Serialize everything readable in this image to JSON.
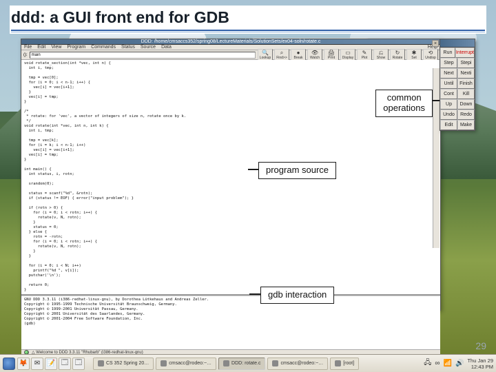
{
  "slide": {
    "title": "ddd: a GUI front end for GDB",
    "number": "29"
  },
  "background": {
    "scene": "mountain-meadow"
  },
  "ddd": {
    "titlebar": "DDD: /home/cmsaccs352/spring08/LectureMaterials/SolutionSets/ex04-soln/rotate.c",
    "close_btn": "×",
    "menu": {
      "file": "File",
      "edit": "Edit",
      "view": "View",
      "program": "Program",
      "commands": "Commands",
      "status": "Status",
      "source": "Source",
      "data": "Data",
      "help": "Help"
    },
    "locator": {
      "label": "():",
      "value": "main"
    },
    "toolbar": [
      {
        "icon": "🔍",
        "label": "Lookup"
      },
      {
        "icon": "⌕",
        "label": "Find>>"
      },
      {
        "icon": "●",
        "label": "Break"
      },
      {
        "icon": "👁",
        "label": "Watch"
      },
      {
        "icon": "🖨",
        "label": "Print"
      },
      {
        "icon": "▭",
        "label": "Display"
      },
      {
        "icon": "✎",
        "label": "Plot"
      },
      {
        "icon": "⎌",
        "label": "Show"
      },
      {
        "icon": "↻",
        "label": "Rotate"
      },
      {
        "icon": "✱",
        "label": "Set"
      },
      {
        "icon": "⟲",
        "label": "Undisp"
      }
    ],
    "source": "void rotate_section(int *vec, int n) {\n  int i, tmp;\n\n  tmp = vec[0];\n  for (i = 0; i < n-1; i++) {\n    vec[i] = vec[i+1];\n  }\n  vec[i] = tmp;\n}\n\n/*\n * rotate: for 'vec', a vector of integers of size n, rotate once by k.\n */\nvoid rotate(int *vec, int n, int k) {\n  int i, tmp;\n\n  tmp = vec[k];\n  for (i = k; i < n-1; i++)\n    vec[i] = vec[i+1];\n  vec[i] = tmp;\n}\n\nint main() {\n  int status, i, rotn;\n\n  srandom(0);\n\n  status = scanf(\"%d\", &rotn);\n  if (status != EOF) { error(\"input problem\"); }\n\n  if (rotn > 0) {\n    for (i = 0; i < rotn; i++) {\n      rotate(v, N, rotn);\n    }\n    status = 0;\n  } else {\n    rotn = -rotn;\n    for (i = 0; i < rotn; i++) {\n      rotate(v, N, rotn);\n    }\n  }\n\n  for (i = 0; i < N; i++)\n    printf(\"%d \", v[i]);\n  putchar('\\n');\n\n  return 0;\n}",
    "console": "GNU DDD 3.3.11 (i386-redhat-linux-gnu), by Dorothea Lütkehaus and Andreas Zeller.\nCopyright © 1995-1999 Technische Universität Braunschweig, Germany.\nCopyright © 1999-2001 Universität Passau, Germany.\nCopyright © 2001 Universität des Saarlandes, Germany.\nCopyright © 2001-2004 Free Software Foundation, Inc.\n(gdb) ",
    "status": "△ Welcome to DDD 3.3.11 \"Rhubarb\" (i386-redhat-linux-gnu)"
  },
  "cmd_tool": {
    "rows": [
      [
        "Run",
        "Interrupt"
      ],
      [
        "Step",
        "Stepi"
      ],
      [
        "Next",
        "Nexti"
      ],
      [
        "Until",
        "Finish"
      ],
      [
        "Cont",
        "Kill"
      ],
      [
        "Up",
        "Down"
      ],
      [
        "Undo",
        "Redo"
      ],
      [
        "Edit",
        "Make"
      ]
    ],
    "interrupt_color": "red"
  },
  "callouts": {
    "common": "common\noperations",
    "source": "program source",
    "gdb": "gdb interaction"
  },
  "taskbar": {
    "quicklaunch_icons": [
      "🦊",
      "✉",
      "📝",
      "🗔",
      "🗔"
    ],
    "tasks": [
      {
        "label": "CS 352 Spring 20…",
        "active": false
      },
      {
        "label": "cmsacc@rodeo:~…",
        "active": false
      },
      {
        "label": "DDD: rotate.c",
        "active": true
      },
      {
        "label": "cmsacc@rodeo:~…",
        "active": false
      },
      {
        "label": "[root]",
        "active": false
      }
    ],
    "tray": {
      "wifi": "📶",
      "vol": "🔊",
      "infinity": "∞",
      "net": "🖧"
    },
    "clock": {
      "date": "Thu Jan 29",
      "time": "12:43 PM"
    }
  }
}
